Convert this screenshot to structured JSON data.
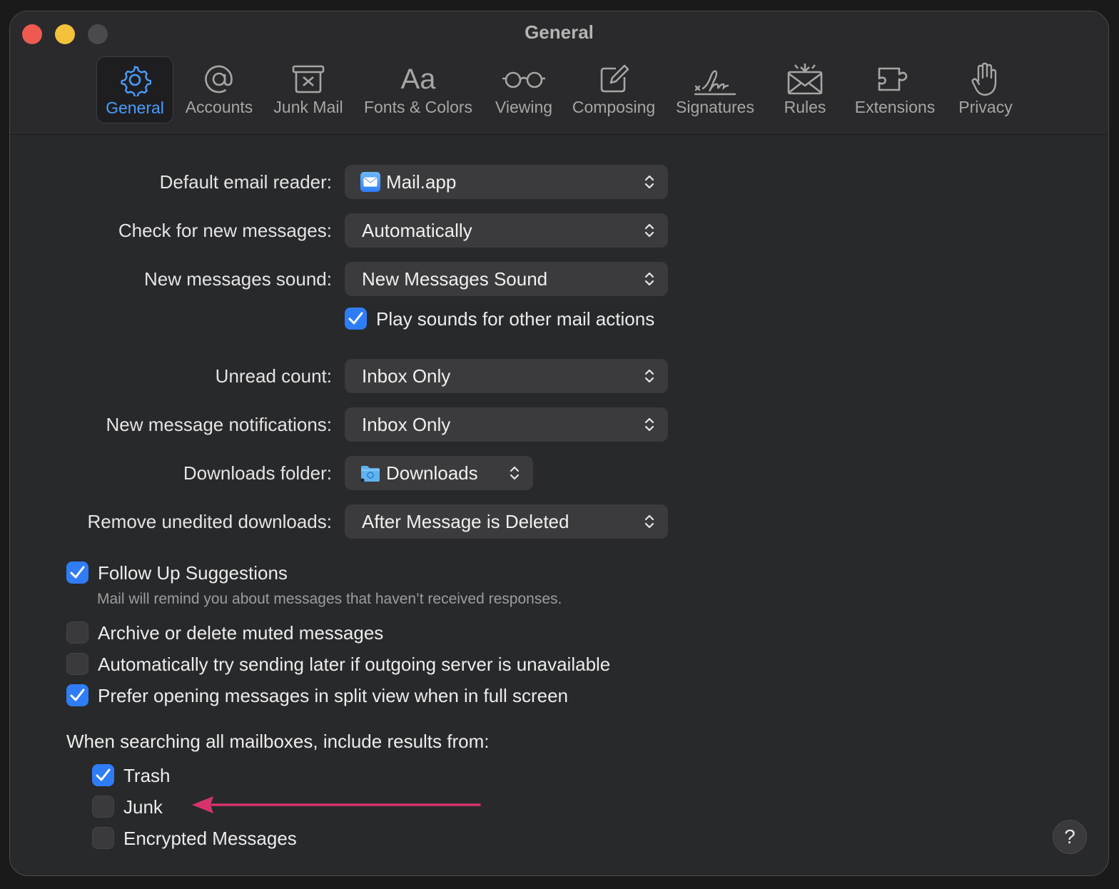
{
  "window": {
    "title": "General"
  },
  "toolbar": {
    "items": [
      {
        "label": "General",
        "icon": "gear-icon",
        "selected": true
      },
      {
        "label": "Accounts",
        "icon": "at-sign-icon"
      },
      {
        "label": "Junk Mail",
        "icon": "junk-box-icon"
      },
      {
        "label": "Fonts & Colors",
        "icon": "font-aa-icon"
      },
      {
        "label": "Viewing",
        "icon": "glasses-icon"
      },
      {
        "label": "Composing",
        "icon": "compose-icon"
      },
      {
        "label": "Signatures",
        "icon": "signature-icon"
      },
      {
        "label": "Rules",
        "icon": "envelope-rules-icon"
      },
      {
        "label": "Extensions",
        "icon": "puzzle-icon"
      },
      {
        "label": "Privacy",
        "icon": "hand-icon"
      }
    ]
  },
  "settings": {
    "default_reader": {
      "label": "Default email reader:",
      "value": "Mail.app"
    },
    "check_new": {
      "label": "Check for new messages:",
      "value": "Automatically"
    },
    "sound": {
      "label": "New messages sound:",
      "value": "New Messages Sound"
    },
    "play_sounds": {
      "label": "Play sounds for other mail actions",
      "checked": true
    },
    "unread_count": {
      "label": "Unread count:",
      "value": "Inbox Only"
    },
    "notifications": {
      "label": "New message notifications:",
      "value": "Inbox Only"
    },
    "downloads_folder": {
      "label": "Downloads folder:",
      "value": "Downloads"
    },
    "remove_downloads": {
      "label": "Remove unedited downloads:",
      "value": "After Message is Deleted"
    }
  },
  "options": {
    "follow_up": {
      "label": "Follow Up Suggestions",
      "checked": true,
      "description": "Mail will remind you about messages that haven’t received responses."
    },
    "archive_muted": {
      "label": "Archive or delete muted messages",
      "checked": false
    },
    "send_later": {
      "label": "Automatically try sending later if outgoing server is unavailable",
      "checked": false
    },
    "split_view": {
      "label": "Prefer opening messages in split view when in full screen",
      "checked": true
    }
  },
  "search": {
    "heading": "When searching all mailboxes, include results from:",
    "trash": {
      "label": "Trash",
      "checked": true
    },
    "junk": {
      "label": "Junk",
      "checked": false
    },
    "encrypted": {
      "label": "Encrypted Messages",
      "checked": false
    }
  },
  "help": {
    "label": "?"
  },
  "colors": {
    "accent": "#2f7df6",
    "selected_tab_text": "#4a9cff",
    "annotation_arrow": "#d6336c",
    "close": "#ee5a52",
    "minimize": "#f4c23a"
  }
}
